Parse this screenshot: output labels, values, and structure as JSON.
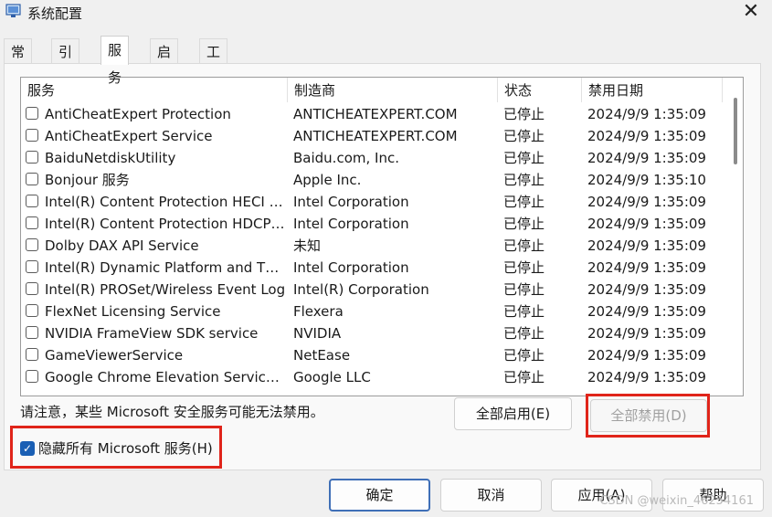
{
  "window": {
    "title": "系统配置",
    "close_symbol": "✕"
  },
  "tabs": [
    {
      "label": "常规"
    },
    {
      "label": "引导"
    },
    {
      "label": "服务",
      "active": true
    },
    {
      "label": "启动"
    },
    {
      "label": "工具"
    }
  ],
  "columns": {
    "service": "服务",
    "manufacturer": "制造商",
    "status": "状态",
    "disabled_date": "禁用日期"
  },
  "services": [
    {
      "name": "AntiCheatExpert Protection",
      "manufacturer": "ANTICHEATEXPERT.COM",
      "status": "已停止",
      "date": "2024/9/9 1:35:09"
    },
    {
      "name": "AntiCheatExpert Service",
      "manufacturer": "ANTICHEATEXPERT.COM",
      "status": "已停止",
      "date": "2024/9/9 1:35:09"
    },
    {
      "name": "BaiduNetdiskUtility",
      "manufacturer": "Baidu.com, Inc.",
      "status": "已停止",
      "date": "2024/9/9 1:35:09"
    },
    {
      "name": "Bonjour 服务",
      "manufacturer": "Apple Inc.",
      "status": "已停止",
      "date": "2024/9/9 1:35:10"
    },
    {
      "name": "Intel(R) Content Protection HECI S...",
      "manufacturer": "Intel Corporation",
      "status": "已停止",
      "date": "2024/9/9 1:35:09"
    },
    {
      "name": "Intel(R) Content Protection HDCP ...",
      "manufacturer": "Intel Corporation",
      "status": "已停止",
      "date": "2024/9/9 1:35:09"
    },
    {
      "name": "Dolby DAX API Service",
      "manufacturer": "未知",
      "status": "已停止",
      "date": "2024/9/9 1:35:09"
    },
    {
      "name": "Intel(R) Dynamic Platform and Ther...",
      "manufacturer": "Intel Corporation",
      "status": "已停止",
      "date": "2024/9/9 1:35:09"
    },
    {
      "name": "Intel(R) PROSet/Wireless Event Log",
      "manufacturer": "Intel(R) Corporation",
      "status": "已停止",
      "date": "2024/9/9 1:35:09"
    },
    {
      "name": "FlexNet Licensing Service",
      "manufacturer": "Flexera",
      "status": "已停止",
      "date": "2024/9/9 1:35:09"
    },
    {
      "name": "NVIDIA FrameView SDK service",
      "manufacturer": "NVIDIA",
      "status": "已停止",
      "date": "2024/9/9 1:35:09"
    },
    {
      "name": "GameViewerService",
      "manufacturer": "NetEase",
      "status": "已停止",
      "date": "2024/9/9 1:35:09"
    },
    {
      "name": "Google Chrome Elevation Service (...",
      "manufacturer": "Google LLC",
      "status": "已停止",
      "date": "2024/9/9 1:35:09"
    }
  ],
  "note": "请注意，某些 Microsoft 安全服务可能无法禁用。",
  "buttons": {
    "enable_all": "全部启用(E)",
    "disable_all": "全部禁用(D)",
    "ok": "确定",
    "cancel": "取消",
    "apply": "应用(A)",
    "help": "帮助"
  },
  "hide_ms": {
    "label": "隐藏所有 Microsoft 服务(H)",
    "checked": true
  },
  "watermark": "CSDN @weixin_46254161",
  "colors": {
    "highlight_box": "#e0241a",
    "accent": "#1a5fb4"
  }
}
